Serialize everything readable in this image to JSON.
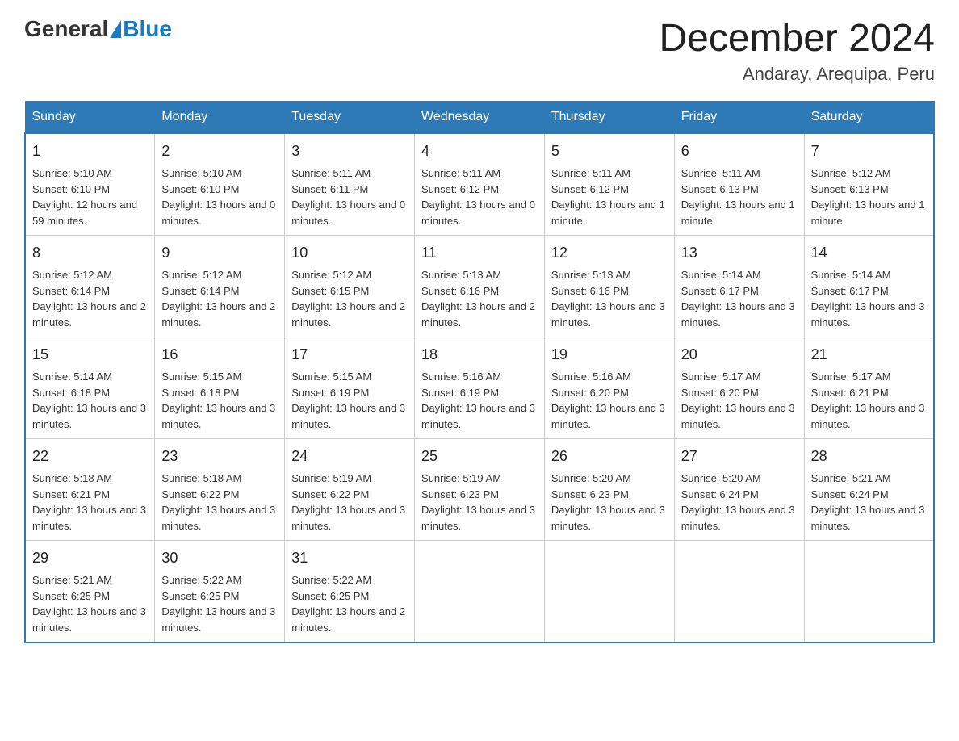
{
  "header": {
    "logo_general": "General",
    "logo_blue": "Blue",
    "month_year": "December 2024",
    "location": "Andaray, Arequipa, Peru"
  },
  "days_of_week": [
    "Sunday",
    "Monday",
    "Tuesday",
    "Wednesday",
    "Thursday",
    "Friday",
    "Saturday"
  ],
  "weeks": [
    [
      {
        "day": "1",
        "sunrise": "5:10 AM",
        "sunset": "6:10 PM",
        "daylight": "12 hours and 59 minutes."
      },
      {
        "day": "2",
        "sunrise": "5:10 AM",
        "sunset": "6:10 PM",
        "daylight": "13 hours and 0 minutes."
      },
      {
        "day": "3",
        "sunrise": "5:11 AM",
        "sunset": "6:11 PM",
        "daylight": "13 hours and 0 minutes."
      },
      {
        "day": "4",
        "sunrise": "5:11 AM",
        "sunset": "6:12 PM",
        "daylight": "13 hours and 0 minutes."
      },
      {
        "day": "5",
        "sunrise": "5:11 AM",
        "sunset": "6:12 PM",
        "daylight": "13 hours and 1 minute."
      },
      {
        "day": "6",
        "sunrise": "5:11 AM",
        "sunset": "6:13 PM",
        "daylight": "13 hours and 1 minute."
      },
      {
        "day": "7",
        "sunrise": "5:12 AM",
        "sunset": "6:13 PM",
        "daylight": "13 hours and 1 minute."
      }
    ],
    [
      {
        "day": "8",
        "sunrise": "5:12 AM",
        "sunset": "6:14 PM",
        "daylight": "13 hours and 2 minutes."
      },
      {
        "day": "9",
        "sunrise": "5:12 AM",
        "sunset": "6:14 PM",
        "daylight": "13 hours and 2 minutes."
      },
      {
        "day": "10",
        "sunrise": "5:12 AM",
        "sunset": "6:15 PM",
        "daylight": "13 hours and 2 minutes."
      },
      {
        "day": "11",
        "sunrise": "5:13 AM",
        "sunset": "6:16 PM",
        "daylight": "13 hours and 2 minutes."
      },
      {
        "day": "12",
        "sunrise": "5:13 AM",
        "sunset": "6:16 PM",
        "daylight": "13 hours and 3 minutes."
      },
      {
        "day": "13",
        "sunrise": "5:14 AM",
        "sunset": "6:17 PM",
        "daylight": "13 hours and 3 minutes."
      },
      {
        "day": "14",
        "sunrise": "5:14 AM",
        "sunset": "6:17 PM",
        "daylight": "13 hours and 3 minutes."
      }
    ],
    [
      {
        "day": "15",
        "sunrise": "5:14 AM",
        "sunset": "6:18 PM",
        "daylight": "13 hours and 3 minutes."
      },
      {
        "day": "16",
        "sunrise": "5:15 AM",
        "sunset": "6:18 PM",
        "daylight": "13 hours and 3 minutes."
      },
      {
        "day": "17",
        "sunrise": "5:15 AM",
        "sunset": "6:19 PM",
        "daylight": "13 hours and 3 minutes."
      },
      {
        "day": "18",
        "sunrise": "5:16 AM",
        "sunset": "6:19 PM",
        "daylight": "13 hours and 3 minutes."
      },
      {
        "day": "19",
        "sunrise": "5:16 AM",
        "sunset": "6:20 PM",
        "daylight": "13 hours and 3 minutes."
      },
      {
        "day": "20",
        "sunrise": "5:17 AM",
        "sunset": "6:20 PM",
        "daylight": "13 hours and 3 minutes."
      },
      {
        "day": "21",
        "sunrise": "5:17 AM",
        "sunset": "6:21 PM",
        "daylight": "13 hours and 3 minutes."
      }
    ],
    [
      {
        "day": "22",
        "sunrise": "5:18 AM",
        "sunset": "6:21 PM",
        "daylight": "13 hours and 3 minutes."
      },
      {
        "day": "23",
        "sunrise": "5:18 AM",
        "sunset": "6:22 PM",
        "daylight": "13 hours and 3 minutes."
      },
      {
        "day": "24",
        "sunrise": "5:19 AM",
        "sunset": "6:22 PM",
        "daylight": "13 hours and 3 minutes."
      },
      {
        "day": "25",
        "sunrise": "5:19 AM",
        "sunset": "6:23 PM",
        "daylight": "13 hours and 3 minutes."
      },
      {
        "day": "26",
        "sunrise": "5:20 AM",
        "sunset": "6:23 PM",
        "daylight": "13 hours and 3 minutes."
      },
      {
        "day": "27",
        "sunrise": "5:20 AM",
        "sunset": "6:24 PM",
        "daylight": "13 hours and 3 minutes."
      },
      {
        "day": "28",
        "sunrise": "5:21 AM",
        "sunset": "6:24 PM",
        "daylight": "13 hours and 3 minutes."
      }
    ],
    [
      {
        "day": "29",
        "sunrise": "5:21 AM",
        "sunset": "6:25 PM",
        "daylight": "13 hours and 3 minutes."
      },
      {
        "day": "30",
        "sunrise": "5:22 AM",
        "sunset": "6:25 PM",
        "daylight": "13 hours and 3 minutes."
      },
      {
        "day": "31",
        "sunrise": "5:22 AM",
        "sunset": "6:25 PM",
        "daylight": "13 hours and 2 minutes."
      },
      null,
      null,
      null,
      null
    ]
  ]
}
